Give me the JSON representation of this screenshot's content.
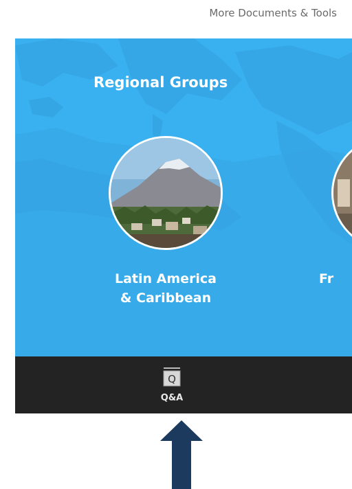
{
  "header": {
    "link_label": "More Documents & Tools"
  },
  "regional_groups": {
    "title": "Regional Groups",
    "groups": [
      {
        "label_line1": "Latin America",
        "label_line2": "& Caribbean"
      },
      {
        "label_line1": "Fr"
      }
    ]
  },
  "bottom_nav": {
    "qa_icon_glyph": "Q",
    "qa_label": "Q&A"
  },
  "icons": {
    "qa": "qa-icon",
    "pointer_arrow": "arrow-up-icon"
  },
  "colors": {
    "map_ocean": "#39b0ef",
    "map_land": "#2f9ada",
    "bottom_bar": "#232323",
    "arrow": "#1c3a5e"
  }
}
